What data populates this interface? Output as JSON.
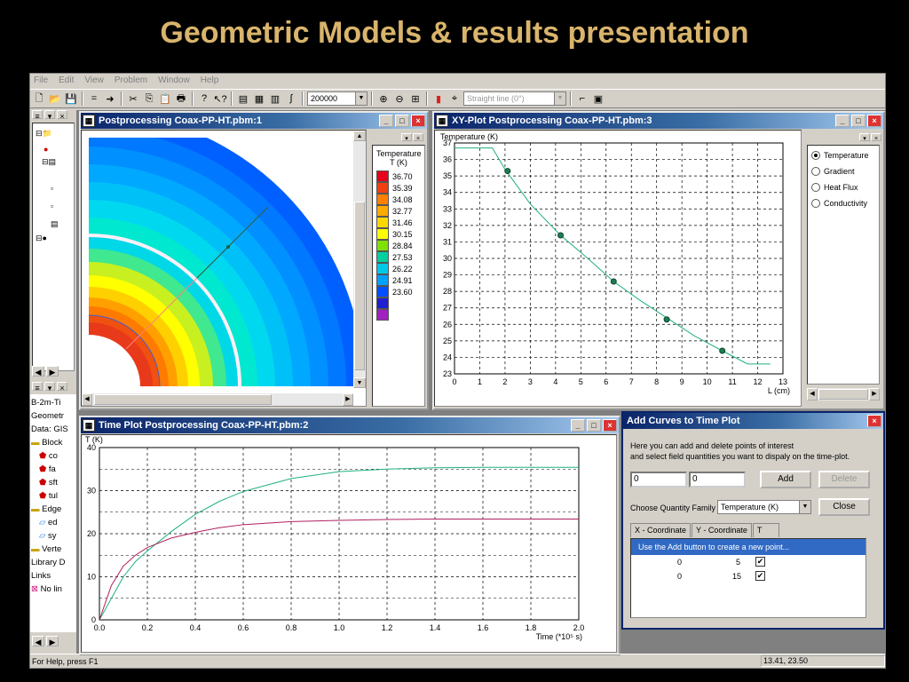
{
  "slide_title": "Geometric Models & results presentation",
  "menu": [
    "File",
    "Edit",
    "View",
    "Problem",
    "Window",
    "Help"
  ],
  "toolbar": {
    "zoom_value": "200000",
    "curve_combo": "Straight line (0°)"
  },
  "status": {
    "help": "For Help, press F1",
    "coords": "13.41, 23.50"
  },
  "tree": {
    "items": [
      "B-2m-Ti",
      "Geometr",
      "Data: GIS",
      "Block",
      "co",
      "fa",
      "sft",
      "tul",
      "Edge",
      "ed",
      "sy",
      "Verte",
      "Library D",
      "Links",
      "No lin"
    ]
  },
  "windows": {
    "field": {
      "title": "Postprocessing Coax-PP-HT.pbm:1"
    },
    "xy": {
      "title": "XY-Plot Postprocessing Coax-PP-HT.pbm:3"
    },
    "time": {
      "title": "Time Plot Postprocessing Coax-PP-HT.pbm:2"
    },
    "dialog": {
      "title": "Add Curves to Time Plot",
      "desc1": "Here you can add and delete points of interest",
      "desc2": "and select field quantities you want to dispaly on the time-plot.",
      "x_value": "0",
      "y_value": "0",
      "add_label": "Add",
      "delete_label": "Delete",
      "close_label": "Close",
      "family_label": "Choose Quantity Family",
      "family_value": "Temperature (K)",
      "tabs": [
        "X - Coordinate",
        "Y - Coordinate",
        "T"
      ],
      "hint_row": "Use the Add button to create a new point...",
      "points": [
        {
          "x": "0",
          "y": "5",
          "checked": true
        },
        {
          "x": "0",
          "y": "15",
          "checked": true
        }
      ]
    }
  },
  "legend": {
    "title1": "Temperature",
    "title2": "T (K)",
    "values": [
      "36.70",
      "35.39",
      "34.08",
      "32.77",
      "31.46",
      "30.15",
      "28.84",
      "27.53",
      "26.22",
      "24.91",
      "23.60"
    ],
    "colors": [
      "#e8001c",
      "#f04010",
      "#ff7f00",
      "#ffaa00",
      "#ffd700",
      "#ffff00",
      "#80e000",
      "#00d0a0",
      "#00c8e8",
      "#00a0ff",
      "#0050ff",
      "#2020d0",
      "#a020c0"
    ]
  },
  "quantities": {
    "options": [
      "Temperature",
      "Gradient",
      "Heat Flux",
      "Conductivity"
    ],
    "selected": "Temperature"
  },
  "chart_data": [
    {
      "type": "line",
      "ylabel": "Temperature (K)",
      "xlabel": "L (cm)",
      "xlim": [
        0,
        13
      ],
      "ylim": [
        23,
        37
      ],
      "x_ticks": [
        0,
        1,
        2,
        3,
        4,
        5,
        6,
        7,
        8,
        9,
        10,
        11,
        12,
        13
      ],
      "y_ticks": [
        23,
        24,
        25,
        26,
        27,
        28,
        29,
        30,
        31,
        32,
        33,
        34,
        35,
        36,
        37
      ],
      "x": [
        0,
        1.5,
        2.0,
        3.0,
        4.2,
        5.2,
        6.3,
        7.4,
        8.5,
        9.5,
        10.6,
        11.6,
        12.5
      ],
      "values": [
        36.7,
        36.7,
        35.4,
        33.3,
        31.4,
        30.1,
        28.6,
        27.4,
        26.3,
        25.3,
        24.4,
        23.6,
        23.6
      ],
      "markers_x": [
        2.1,
        4.2,
        6.3,
        8.4,
        10.6
      ],
      "markers_y": [
        35.3,
        31.4,
        28.6,
        26.3,
        24.4
      ],
      "color": "#20b080",
      "grid": true
    },
    {
      "type": "line",
      "ylabel": "T (K)",
      "xlabel": "Time (*10⁵ s)",
      "xlim": [
        0,
        2.0
      ],
      "ylim": [
        0,
        40
      ],
      "x_ticks": [
        "0.0",
        "0.2",
        "0.4",
        "0.6",
        "0.8",
        "1.0",
        "1.2",
        "1.4",
        "1.6",
        "1.8",
        "2.0"
      ],
      "y_ticks": [
        0,
        10,
        20,
        30,
        40
      ],
      "x": [
        0,
        0.05,
        0.1,
        0.15,
        0.2,
        0.3,
        0.4,
        0.5,
        0.6,
        0.8,
        1.0,
        1.2,
        1.4,
        1.6,
        1.8,
        2.0
      ],
      "series": [
        {
          "values": [
            0,
            5,
            10,
            13.5,
            16,
            20.5,
            24.5,
            27.5,
            29.8,
            32.8,
            34.4,
            35.0,
            35.3,
            35.4,
            35.4,
            35.4
          ],
          "color": "#20b080"
        },
        {
          "values": [
            0,
            8,
            12.5,
            15,
            16.8,
            19,
            20.3,
            21.4,
            22.1,
            22.8,
            23.1,
            23.3,
            23.4,
            23.4,
            23.4,
            23.4
          ],
          "color": "#b02060"
        }
      ],
      "grid": true
    }
  ]
}
